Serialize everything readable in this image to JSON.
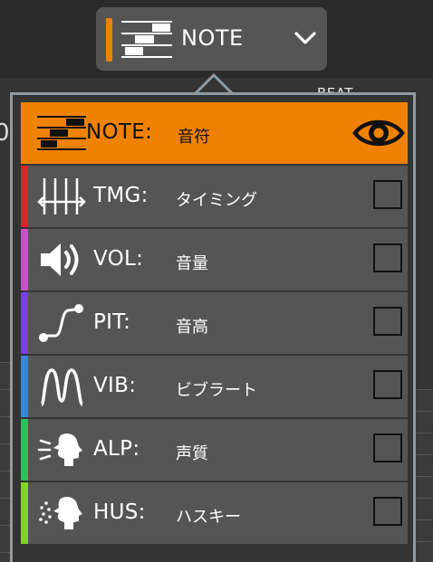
{
  "background": {
    "beat_label": "BEAT",
    "left_digit": "0"
  },
  "selector": {
    "label": "NOTE",
    "accent_color": "#ef8200",
    "icon": "note-bars-icon",
    "dropdown_icon": "chevron-down-icon"
  },
  "items": [
    {
      "code": "NOTE:",
      "name": "音符",
      "icon": "note-bars-icon",
      "color": "#ef8200",
      "state": "visible",
      "state_icon": "eye-icon"
    },
    {
      "code": "TMG:",
      "name": "タイミング",
      "icon": "timing-icon",
      "color": "#d9262c",
      "state": "unchecked"
    },
    {
      "code": "VOL:",
      "name": "音量",
      "icon": "speaker-icon",
      "color": "#c553c7",
      "state": "unchecked"
    },
    {
      "code": "PIT:",
      "name": "音高",
      "icon": "pitch-curve-icon",
      "color": "#7b3fe2",
      "state": "unchecked"
    },
    {
      "code": "VIB:",
      "name": "ビブラート",
      "icon": "vibrato-wave-icon",
      "color": "#3c85d4",
      "state": "unchecked"
    },
    {
      "code": "ALP:",
      "name": "声質",
      "icon": "alpha-voice-icon",
      "color": "#2fc05a",
      "state": "unchecked"
    },
    {
      "code": "HUS:",
      "name": "ハスキー",
      "icon": "husky-voice-icon",
      "color": "#82d32a",
      "state": "unchecked"
    }
  ]
}
